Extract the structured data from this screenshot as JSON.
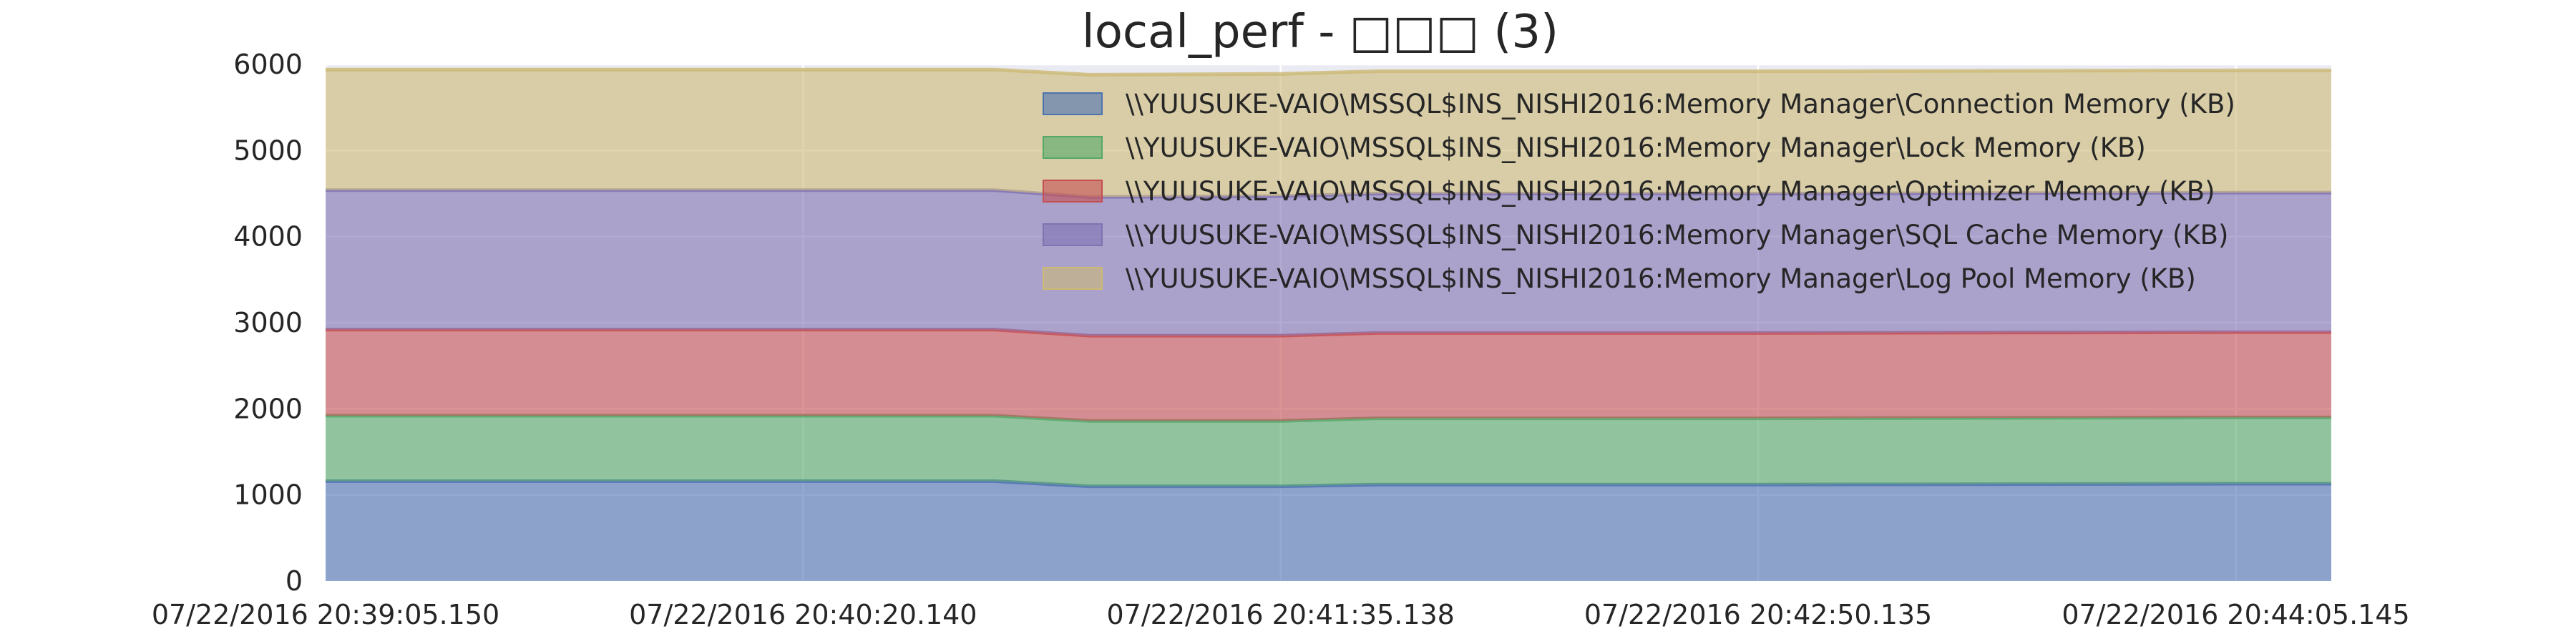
{
  "chart_data": {
    "type": "area",
    "stacked": true,
    "title": "local_perf - □□□ (3)",
    "xlabel": "",
    "ylabel": "",
    "ylim": [
      0,
      6000
    ],
    "yticks": [
      0,
      1000,
      2000,
      3000,
      4000,
      5000,
      6000
    ],
    "x": [
      "07/22/2016 20:39:05.150",
      "07/22/2016 20:40:20.140",
      "07/22/2016 20:40:50.139",
      "07/22/2016 20:41:05.138",
      "07/22/2016 20:41:35.138",
      "07/22/2016 20:41:50.136",
      "07/22/2016 20:42:50.135",
      "07/22/2016 20:44:05.145",
      "07/22/2016 20:44:20.145"
    ],
    "xticks": [
      "07/22/2016 20:39:05.150",
      "07/22/2016 20:40:20.140",
      "07/22/2016 20:41:35.138",
      "07/22/2016 20:42:50.135",
      "07/22/2016 20:44:05.145"
    ],
    "grid": true,
    "legend_position": "upper-right",
    "background_color": "#eaeaf2",
    "series": [
      {
        "name": "\\\\YUUSUKE-VAIO\\MSSQL$INS_NISHI2016:Memory Manager\\Connection Memory (KB)",
        "color": "#4c72b0",
        "values": [
          1160,
          1160,
          1160,
          1100,
          1100,
          1120,
          1120,
          1130,
          1130
        ]
      },
      {
        "name": "\\\\YUUSUKE-VAIO\\MSSQL$INS_NISHI2016:Memory Manager\\Lock Memory (KB)",
        "color": "#55a868",
        "values": [
          760,
          760,
          760,
          760,
          760,
          770,
          770,
          770,
          770
        ]
      },
      {
        "name": "\\\\YUUSUKE-VAIO\\MSSQL$INS_NISHI2016:Memory Manager\\Optimizer Memory (KB)",
        "color": "#c44e52",
        "values": [
          1000,
          1000,
          1000,
          990,
          990,
          990,
          990,
          990,
          990
        ]
      },
      {
        "name": "\\\\YUUSUKE-VAIO\\MSSQL$INS_NISHI2016:Memory Manager\\SQL Cache Memory (KB)",
        "color": "#8172b2",
        "values": [
          1620,
          1620,
          1620,
          1610,
          1620,
          1620,
          1620,
          1620,
          1620
        ]
      },
      {
        "name": "\\\\YUUSUKE-VAIO\\MSSQL$INS_NISHI2016:Memory Manager\\Log Pool Memory (KB)",
        "color": "#ccb974",
        "values": [
          1400,
          1400,
          1400,
          1420,
          1420,
          1420,
          1420,
          1420,
          1420
        ]
      }
    ]
  }
}
